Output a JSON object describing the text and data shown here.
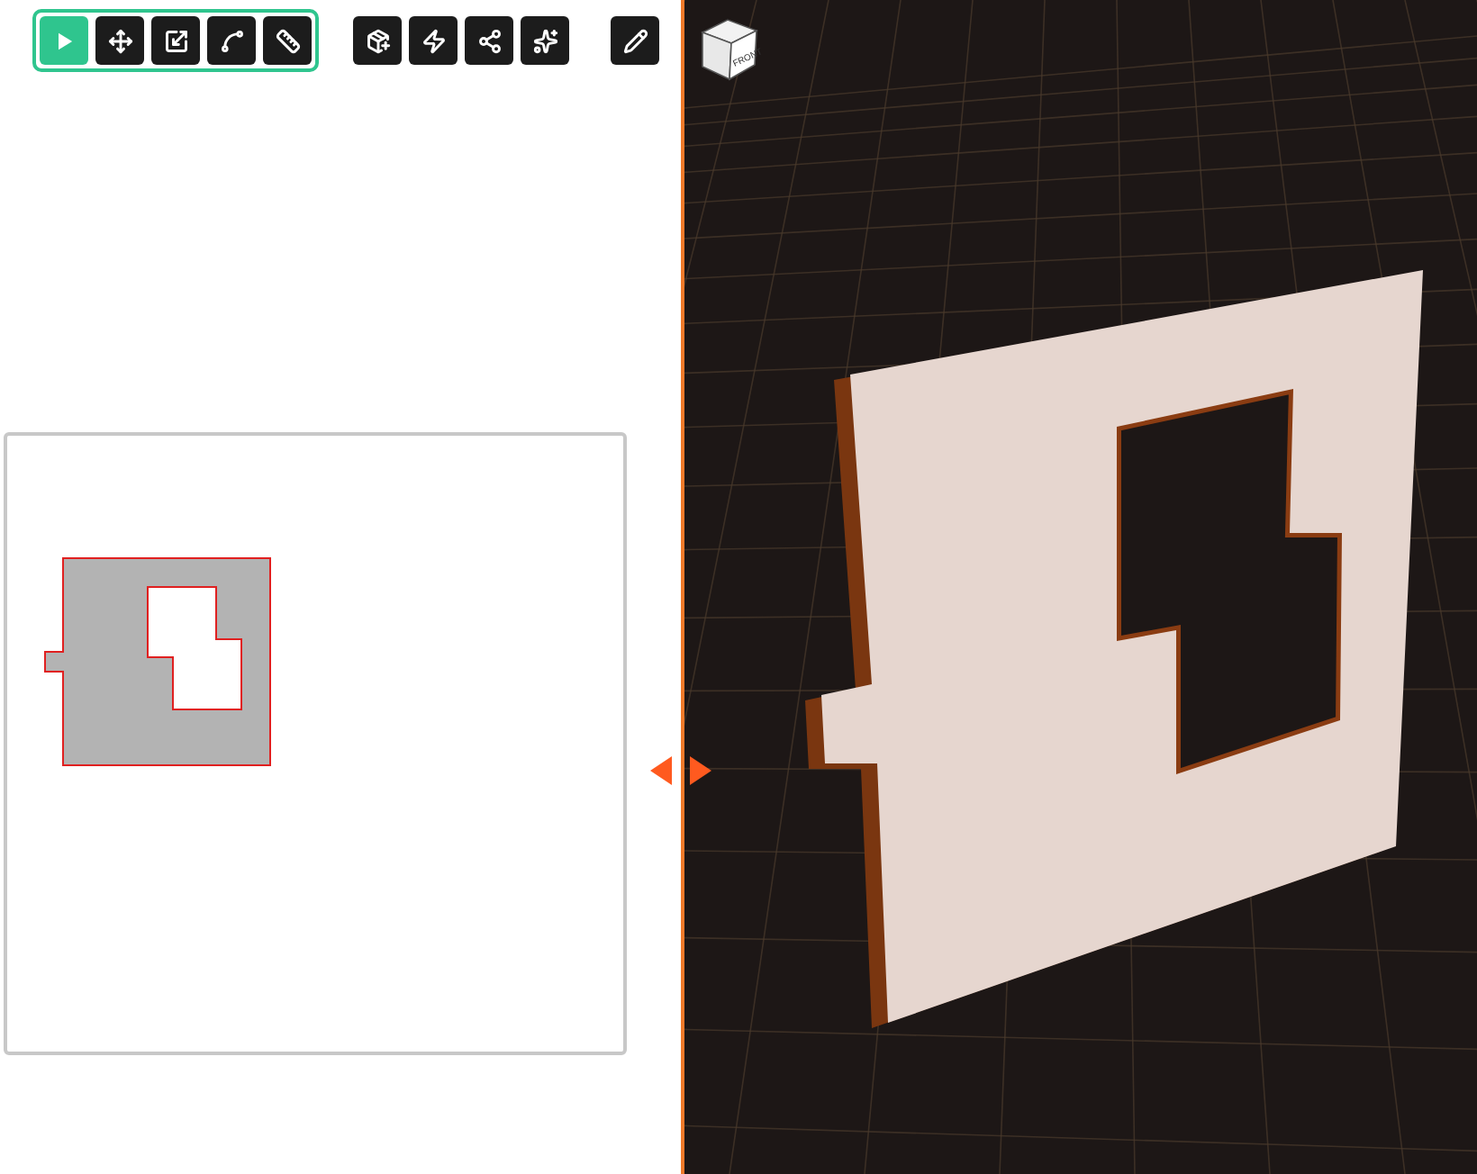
{
  "toolbar": {
    "groups": [
      {
        "framed": true,
        "tools": [
          {
            "kind": "pointer",
            "selected": true
          },
          {
            "kind": "move",
            "selected": false
          },
          {
            "kind": "scale",
            "selected": false
          },
          {
            "kind": "nodes",
            "selected": false
          },
          {
            "kind": "measure",
            "selected": false
          }
        ]
      },
      {
        "framed": false,
        "tools": [
          {
            "kind": "add-box",
            "selected": false
          },
          {
            "kind": "laser",
            "selected": false
          },
          {
            "kind": "share",
            "selected": false
          },
          {
            "kind": "sparkles",
            "selected": false
          }
        ]
      },
      {
        "framed": false,
        "tools": [
          {
            "kind": "pencil",
            "selected": false
          }
        ]
      }
    ]
  },
  "viewport": {
    "view_cube": {
      "face_label": "FRONT"
    }
  }
}
